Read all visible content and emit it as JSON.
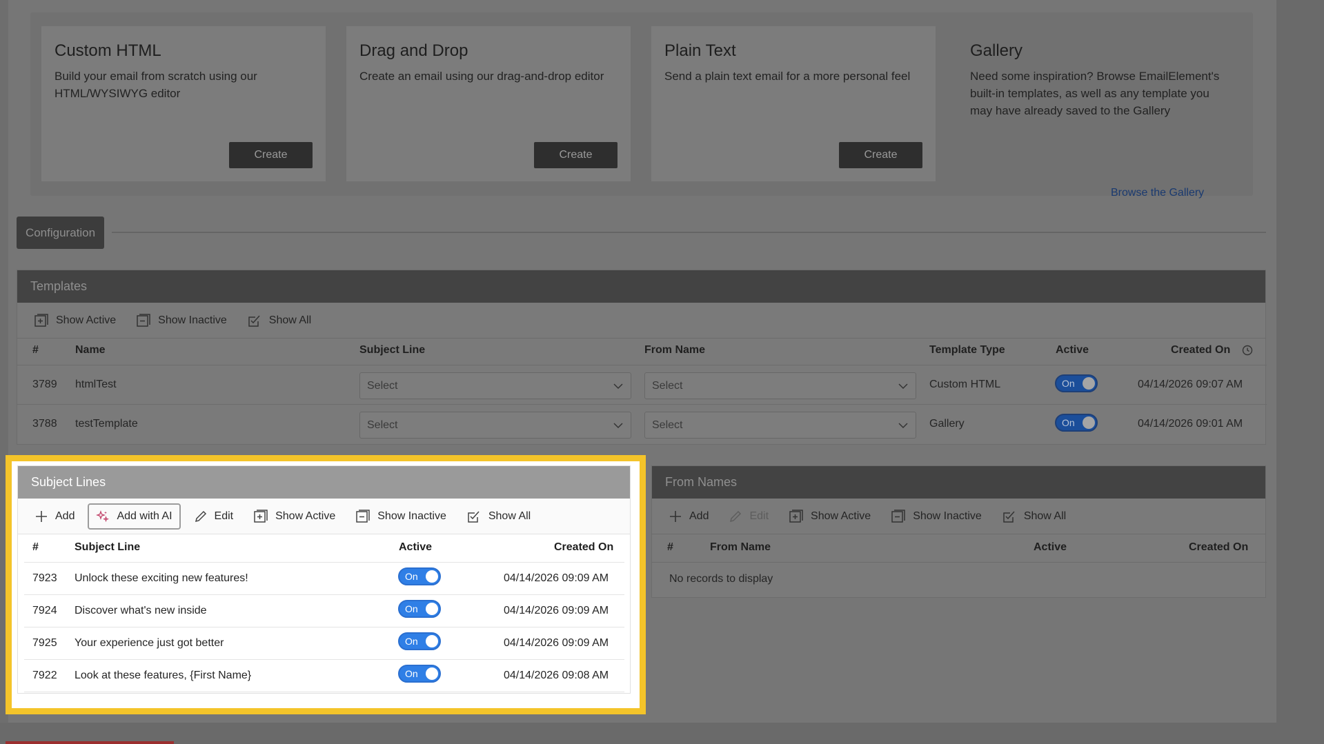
{
  "cards": [
    {
      "title": "Custom HTML",
      "desc": "Build your email from scratch using our HTML/WYSIWYG editor",
      "button": "Create"
    },
    {
      "title": "Drag and Drop",
      "desc": "Create an email using our drag-and-drop editor",
      "button": "Create"
    },
    {
      "title": "Plain Text",
      "desc": "Send a plain text email for a more personal feel",
      "button": "Create"
    }
  ],
  "gallery": {
    "title": "Gallery",
    "desc": "Need some inspiration? Browse EmailElement's built-in templates, as well as any template you may have already saved to the Gallery",
    "link": "Browse the Gallery"
  },
  "configuration": "Configuration",
  "templates": {
    "title": "Templates",
    "toolbar": [
      "Show Active",
      "Show Inactive",
      "Show All"
    ],
    "columns": {
      "num": "#",
      "name": "Name",
      "subject": "Subject Line",
      "from": "From Name",
      "type": "Template Type",
      "active": "Active",
      "created": "Created On"
    },
    "rows": [
      {
        "id": "3789",
        "name": "htmlTest",
        "subject": "Select",
        "from": "Select",
        "type": "Custom HTML",
        "active": "On",
        "created": "04/14/2026 09:07 AM"
      },
      {
        "id": "3788",
        "name": "testTemplate",
        "subject": "Select",
        "from": "Select",
        "type": "Gallery",
        "active": "On",
        "created": "04/14/2026 09:01 AM"
      }
    ]
  },
  "subject_lines": {
    "title": "Subject Lines",
    "toolbar": {
      "add": "Add",
      "add_ai": "Add with AI",
      "edit": "Edit",
      "show_active": "Show Active",
      "show_inactive": "Show Inactive",
      "show_all": "Show All"
    },
    "columns": {
      "num": "#",
      "subject": "Subject Line",
      "active": "Active",
      "created": "Created On"
    },
    "rows": [
      {
        "id": "7923",
        "subject": "Unlock these exciting new features!",
        "active": "On",
        "created": "04/14/2026 09:09 AM"
      },
      {
        "id": "7924",
        "subject": "Discover what's new inside",
        "active": "On",
        "created": "04/14/2026 09:09 AM"
      },
      {
        "id": "7925",
        "subject": "Your experience just got better",
        "active": "On",
        "created": "04/14/2026 09:09 AM"
      },
      {
        "id": "7922",
        "subject": "Look at these features, {First Name}",
        "active": "On",
        "created": "04/14/2026 09:08 AM"
      }
    ]
  },
  "from_names": {
    "title": "From Names",
    "toolbar": {
      "add": "Add",
      "edit": "Edit",
      "show_active": "Show Active",
      "show_inactive": "Show Inactive",
      "show_all": "Show All"
    },
    "columns": {
      "num": "#",
      "from": "From Name",
      "active": "Active",
      "created": "Created On"
    },
    "empty": "No records to display"
  },
  "colors": {
    "highlight": "#f4c42a",
    "toggle_on": "#2f7fe6",
    "link": "#1a3a70"
  }
}
